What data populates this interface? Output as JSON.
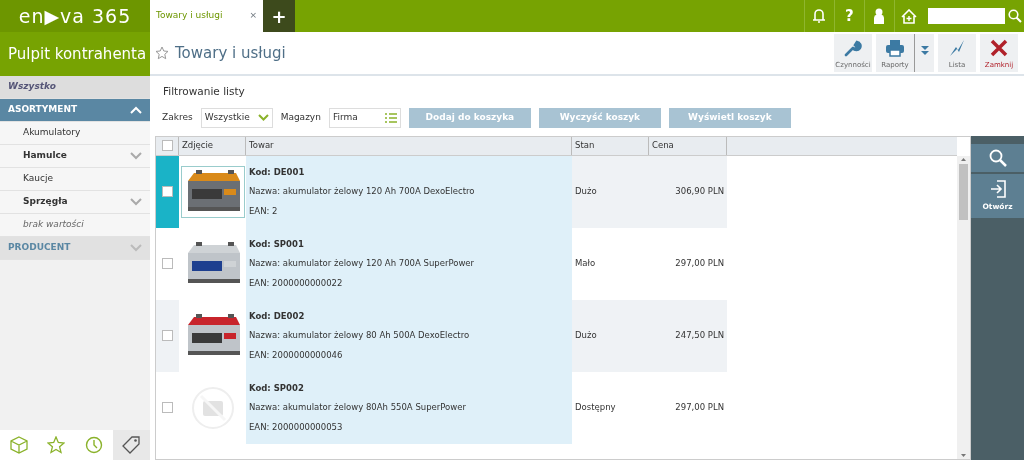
{
  "app": {
    "logo": "en▶va 365",
    "tab": {
      "label": "Towary i usługi",
      "close": "×",
      "selected": true
    },
    "new_tab": "+",
    "help": "?"
  },
  "sidebar": {
    "title": "Pulpit kontrahenta",
    "items": [
      {
        "label": "Wszystko",
        "kind": "all",
        "selected": true
      },
      {
        "label": "ASORTYMENT",
        "kind": "group",
        "expanded": true,
        "children": [
          {
            "label": "Akumulatory",
            "kind": "item"
          },
          {
            "label": "Hamulce",
            "kind": "folder",
            "expanded": false
          },
          {
            "label": "Kaucje",
            "kind": "item"
          },
          {
            "label": "Sprzęgła",
            "kind": "folder",
            "expanded": false
          },
          {
            "label": "brak wartości",
            "kind": "none"
          }
        ]
      },
      {
        "label": "PRODUCENT",
        "kind": "group",
        "expanded": false
      }
    ]
  },
  "page": {
    "title": "Towary i usługi",
    "toolbar": [
      {
        "label": "Czynności",
        "kind": "wrench"
      },
      {
        "label": "Raporty",
        "kind": "printer"
      },
      {
        "kind": "more"
      },
      {
        "label": "Lista",
        "kind": "bolt"
      },
      {
        "label": "Zamknij",
        "kind": "close"
      }
    ]
  },
  "filter": {
    "title": "Filtrowanie listy",
    "zakres_label": "Zakres",
    "zakres_value": "Wszystkie",
    "magazyn_label": "Magazyn",
    "magazyn_value": "Firma",
    "buttons": [
      "Dodaj do koszyka",
      "Wyczyść koszyk",
      "Wyświetl koszyk"
    ]
  },
  "table": {
    "all_selected": false,
    "columns": [
      "Zdjęcie",
      "Towar",
      "Stan",
      "Cena"
    ],
    "rows": [
      {
        "selected": true,
        "kind": "picture",
        "kod": "Kod: DE001",
        "nazwa": "Nazwa: akumulator żelowy 120 Ah 700A DexoElectro",
        "ean": "EAN: 2",
        "stan": "Dużo",
        "cena": "306,90 PLN"
      },
      {
        "selected": false,
        "kind": "picture",
        "kod": "Kod: SP001",
        "nazwa": "Nazwa: akumulator żelowy 120 Ah 700A SuperPower",
        "ean": "EAN: 2000000000022",
        "stan": "Mało",
        "cena": "297,00 PLN"
      },
      {
        "selected": false,
        "kind": "picture",
        "kod": "Kod: DE002",
        "nazwa": "Nazwa: akumulator żelowy 80 Ah 500A DexoElectro",
        "ean": "EAN: 2000000000046",
        "stan": "Dużo",
        "cena": "247,50 PLN"
      },
      {
        "selected": false,
        "kind": "no-photo",
        "kod": "Kod: SP002",
        "nazwa": "Nazwa: akumulator żelowy 80Ah 550A SuperPower",
        "ean": "EAN: 2000000000053",
        "stan": "Dostępny",
        "cena": "297,00 PLN"
      }
    ]
  },
  "side_actions": [
    {
      "kind": "search"
    },
    {
      "label": "Otwórz",
      "kind": "open"
    }
  ]
}
